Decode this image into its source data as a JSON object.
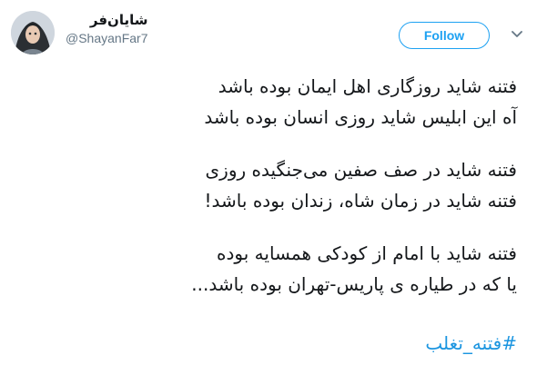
{
  "author": {
    "display_name": "شایان‌فر",
    "handle": "@ShayanFar7",
    "avatar_icon": "profile-photo"
  },
  "actions": {
    "follow_label": "Follow",
    "more_icon": "chevron-down-icon"
  },
  "tweet": {
    "stanza1": {
      "line1": "فتنه شاید روزگاری اهل ایمان بوده باشد",
      "line2": "آه این ابلیس شاید روزی انسان بوده باشد"
    },
    "stanza2": {
      "line1": "فتنه شاید در صف صفین می‌جنگیده روزی",
      "line2": "فتنه شاید در زمان شاه، زندان بوده باشد!"
    },
    "stanza3": {
      "line1": "فتنه شاید با امام از کودکی همسایه بوده",
      "line2": "یا که در طیاره ی پاریس-تهران بوده باشد..."
    },
    "hashtag": "#فتنه_تغلب"
  },
  "colors": {
    "accent": "#1da1f2",
    "link": "#1b95e0",
    "text": "#14171a",
    "secondary": "#657786"
  }
}
